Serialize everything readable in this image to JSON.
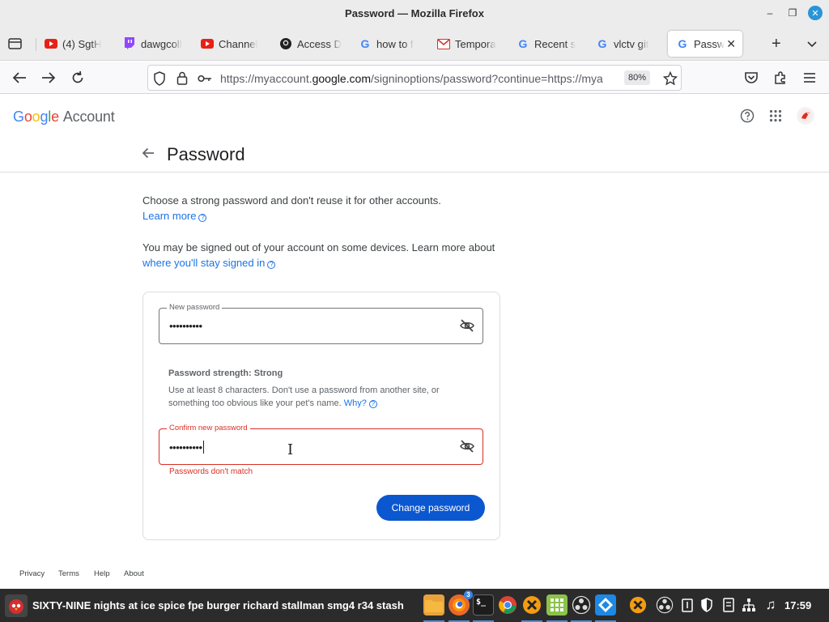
{
  "window": {
    "title": "Password — Mozilla Firefox",
    "minimize_glyph": "–",
    "maximize_glyph": "❐",
    "close_glyph": "✕"
  },
  "tabs": [
    {
      "label": "(4) SgtH",
      "icon": "youtube-icon"
    },
    {
      "label": "dawgcoll",
      "icon": "twitch-icon"
    },
    {
      "label": "Channel",
      "icon": "youtube-icon"
    },
    {
      "label": "Access D",
      "icon": "github-icon"
    },
    {
      "label": "how to f",
      "icon": "google-icon"
    },
    {
      "label": "Tempora",
      "icon": "mail-icon"
    },
    {
      "label": "Recent s",
      "icon": "google-icon"
    },
    {
      "label": "vlctv git",
      "icon": "google-icon"
    },
    {
      "label": "Passw",
      "icon": "google-icon",
      "active": true
    }
  ],
  "tab_close_glyph": "✕",
  "new_tab_glyph": "+",
  "navbar": {
    "url_prefix": "https://myaccount.",
    "url_domain": "google.com",
    "url_suffix": "/signinoptions/password?continue=https://mya",
    "zoom": "80%"
  },
  "page": {
    "logo_letters": [
      {
        "ch": "G",
        "color": "#4285F4"
      },
      {
        "ch": "o",
        "color": "#EA4335"
      },
      {
        "ch": "o",
        "color": "#FBBC05"
      },
      {
        "ch": "g",
        "color": "#4285F4"
      },
      {
        "ch": "l",
        "color": "#34A853"
      },
      {
        "ch": "e",
        "color": "#EA4335"
      }
    ],
    "logo_suffix": "Account",
    "title": "Password",
    "intro_text": "Choose a strong password and don't reuse it for other accounts.",
    "learn_more": "Learn more",
    "signed_out_text": "You may be signed out of your account on some devices. Learn more about",
    "stay_signed_link": "where you'll stay signed in",
    "help_glyph": "?",
    "new_password": {
      "label": "New password",
      "value": "••••••••••"
    },
    "strength_title": "Password strength: Strong",
    "strength_desc": "Use at least 8 characters. Don't use a password from another site, or something too obvious like your pet's name.",
    "why_link": "Why?",
    "confirm_password": {
      "label": "Confirm new password",
      "value": "••••••••••"
    },
    "error_message": "Passwords don't match",
    "change_button": "Change password",
    "footer": [
      "Privacy",
      "Terms",
      "Help",
      "About"
    ]
  },
  "taskbar": {
    "window_title": "SIXTY-NINE nights at ice spice fpe burger richard stallman smg4 r34 stash",
    "firefox_badge": "3",
    "terminal_label": "$_",
    "clock": "17:59"
  },
  "colors": {
    "link": "#1a73e8",
    "error": "#d93025",
    "button": "#0b57d0"
  }
}
